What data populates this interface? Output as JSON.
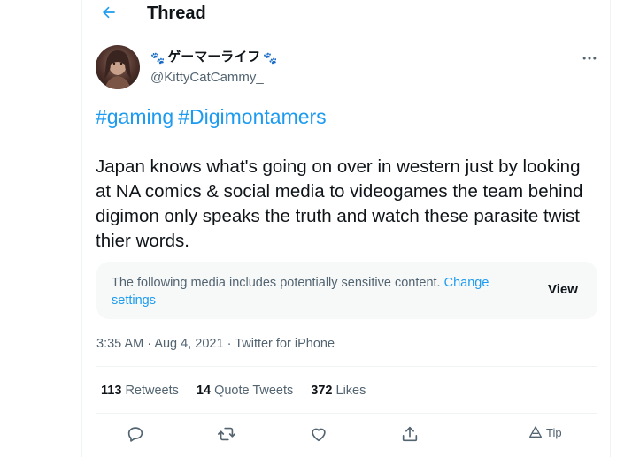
{
  "header": {
    "title": "Thread",
    "back_icon": "back-arrow-icon",
    "accent": "#1d9bf0"
  },
  "author": {
    "display_name": "ゲーマーライフ",
    "name_emoji_left": "🐾",
    "name_emoji_right": "🐾",
    "handle": "@KittyCatCammy_"
  },
  "tweet": {
    "hashtags": [
      "#gaming",
      "#Digimontamers"
    ],
    "text": "Japan knows what's going on over in western just by looking at NA comics & social media to videogames the team behind digimon only speaks the truth and watch these parasite twist thier words."
  },
  "sensitive_notice": {
    "text": "The following media includes potentially sensitive content.",
    "link_label": "Change settings",
    "view_label": "View"
  },
  "meta": {
    "time": "3:35 AM",
    "separator": "·",
    "date": "Aug 4, 2021",
    "source": "Twitter for iPhone"
  },
  "stats": {
    "retweets_count": "113",
    "retweets_label": "Retweets",
    "quotes_count": "14",
    "quotes_label": "Quote Tweets",
    "likes_count": "372",
    "likes_label": "Likes"
  },
  "actions": {
    "reply_icon": "reply-icon",
    "retweet_icon": "retweet-icon",
    "like_icon": "heart-icon",
    "share_icon": "share-icon",
    "tip_label": "Tip"
  },
  "colors": {
    "text": "#0f1419",
    "secondary": "#536471",
    "link": "#1d9bf0",
    "border": "#eff3f4",
    "notice_bg": "#f7f9f9"
  }
}
